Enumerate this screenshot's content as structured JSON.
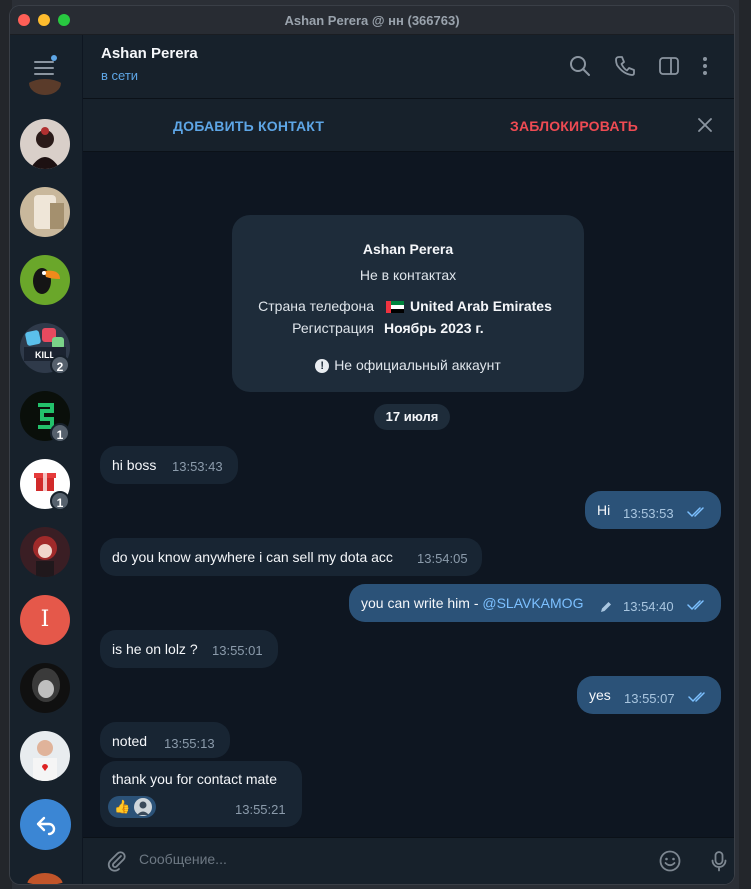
{
  "window": {
    "title": "Ashan Perera @ нн (366763)"
  },
  "header": {
    "name": "Ashan Perera",
    "status": "в сети"
  },
  "icons": [
    "search-icon",
    "phone-icon",
    "sidebar-toggle-icon",
    "more-icon"
  ],
  "actions": {
    "add_contact": "ДОБАВИТЬ КОНТАКТ",
    "block": "ЗАБЛОКИРОВАТЬ"
  },
  "info_card": {
    "name": "Ashan Perera",
    "subtitle": "Не в контактах",
    "rows": [
      {
        "label": "Страна телефона",
        "value": "United Arab Emirates"
      },
      {
        "label": "Регистрация",
        "value": "Ноябрь 2023 г."
      }
    ],
    "note": "Не официальный аккаунт"
  },
  "date_separator": "17 июля",
  "messages": [
    {
      "dir": "in",
      "text": "hi boss",
      "time": "13:53:43"
    },
    {
      "dir": "out",
      "text": "Hi",
      "time": "13:53:53"
    },
    {
      "dir": "in",
      "text": "do you know anywhere i can sell my dota acc",
      "time": "13:54:05"
    },
    {
      "dir": "out",
      "text": "you can write him - ",
      "mention": "@SLAVKAMOG",
      "time": "13:54:40",
      "edited": true
    },
    {
      "dir": "in",
      "text": "is he on lolz ?",
      "time": "13:55:01"
    },
    {
      "dir": "out",
      "text": "yes",
      "time": "13:55:07"
    },
    {
      "dir": "in",
      "text": "noted",
      "time": "13:55:13"
    },
    {
      "dir": "in",
      "text": "thank you for contact mate",
      "time": "13:55:21",
      "reaction": "👍"
    }
  ],
  "sidebar": {
    "badges": [
      "2",
      "1",
      "1"
    ],
    "avatar_letter": "I"
  },
  "composer": {
    "placeholder": "Сообщение..."
  },
  "colors": {
    "accent": "#5ea6e6",
    "danger": "#ef4b53",
    "outgoing": "#2b5278",
    "incoming": "#182533"
  }
}
